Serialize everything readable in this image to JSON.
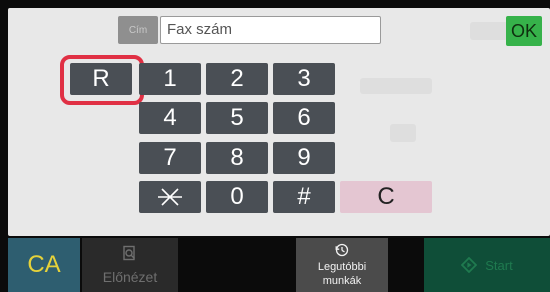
{
  "header": {
    "address_button_label": "Cím",
    "fax_input_placeholder": "Fax szám",
    "ok_label": "OK"
  },
  "keypad": {
    "r_label": "R",
    "rows": [
      [
        "1",
        "2",
        "3"
      ],
      [
        "4",
        "5",
        "6"
      ],
      [
        "7",
        "8",
        "9"
      ]
    ],
    "bottom_row": {
      "zero": "0",
      "hash": "#"
    },
    "clear_label": "C"
  },
  "bottom": {
    "ca_label": "CA",
    "preview_label": "Előnézet",
    "recent_jobs_label": "Legutóbbi munkák",
    "start_label": "Start"
  },
  "colors": {
    "key_bg": "#4a4f55",
    "highlight": "#e03044",
    "ok_bg": "#36b24a",
    "clear_bg": "#e4c6d2",
    "ca_text": "#e6d23a"
  }
}
